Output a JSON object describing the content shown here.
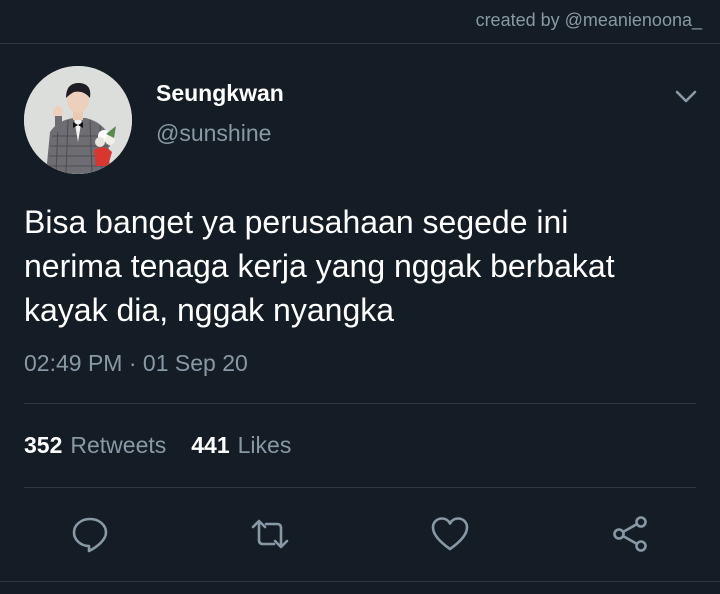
{
  "watermark": "created by @meanienoona_",
  "user": {
    "display_name": "Seungkwan",
    "handle": "@sunshine"
  },
  "tweet": {
    "text": "Bisa banget ya perusahaan segede ini\nnerima tenaga kerja yang nggak berbakat\nkayak dia, nggak nyangka",
    "time": "02:49 PM",
    "separator": "·",
    "date": "01 Sep 20"
  },
  "stats": {
    "retweets_count": "352",
    "retweets_label": "Retweets",
    "likes_count": "441",
    "likes_label": "Likes"
  },
  "icons": {
    "more": "chevron-down-icon",
    "reply": "reply-icon",
    "retweet": "retweet-icon",
    "like": "heart-icon",
    "share": "share-icon"
  },
  "colors": {
    "background": "#141d26",
    "text_primary": "#ffffff",
    "text_secondary": "#8899a6",
    "divider": "#2a3945"
  }
}
